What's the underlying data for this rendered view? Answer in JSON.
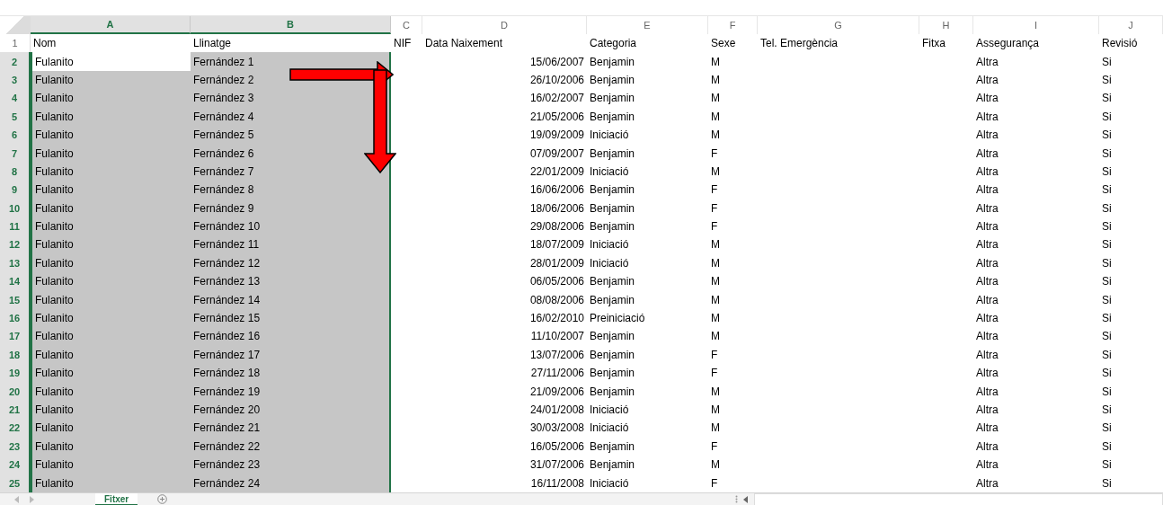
{
  "columns": [
    {
      "letter": "A",
      "selected": true
    },
    {
      "letter": "B",
      "selected": true
    },
    {
      "letter": "C",
      "selected": false
    },
    {
      "letter": "D",
      "selected": false
    },
    {
      "letter": "E",
      "selected": false
    },
    {
      "letter": "F",
      "selected": false
    },
    {
      "letter": "G",
      "selected": false
    },
    {
      "letter": "H",
      "selected": false
    },
    {
      "letter": "I",
      "selected": false
    },
    {
      "letter": "J",
      "selected": false
    }
  ],
  "header_row": {
    "number": "1",
    "cells": {
      "A": "Nom",
      "B": "Llinatge",
      "C": "NIF",
      "D": "Data Naixement",
      "E": "Categoria",
      "F": "Sexe",
      "G": "Tel. Emergència",
      "H": "Fitxa",
      "I": "Assegurança",
      "J": "Revisió"
    }
  },
  "rows": [
    {
      "number": "2",
      "selected": true,
      "active": true,
      "cells": {
        "A": "Fulanito",
        "B": "Fernández 1",
        "D": "15/06/2007",
        "E": "Benjamin",
        "F": "M",
        "I": "Altra",
        "J": "Si"
      }
    },
    {
      "number": "3",
      "selected": true,
      "active": false,
      "cells": {
        "A": "Fulanito",
        "B": "Fernández 2",
        "D": "26/10/2006",
        "E": "Benjamin",
        "F": "M",
        "I": "Altra",
        "J": "Si"
      }
    },
    {
      "number": "4",
      "selected": true,
      "active": false,
      "cells": {
        "A": "Fulanito",
        "B": "Fernández 3",
        "D": "16/02/2007",
        "E": "Benjamin",
        "F": "M",
        "I": "Altra",
        "J": "Si"
      }
    },
    {
      "number": "5",
      "selected": true,
      "active": false,
      "cells": {
        "A": "Fulanito",
        "B": "Fernández 4",
        "D": "21/05/2006",
        "E": "Benjamin",
        "F": "M",
        "I": "Altra",
        "J": "Si"
      }
    },
    {
      "number": "6",
      "selected": true,
      "active": false,
      "cells": {
        "A": "Fulanito",
        "B": "Fernández 5",
        "D": "19/09/2009",
        "E": "Iniciació",
        "F": "M",
        "I": "Altra",
        "J": "Si"
      }
    },
    {
      "number": "7",
      "selected": true,
      "active": false,
      "cells": {
        "A": "Fulanito",
        "B": "Fernández 6",
        "D": "07/09/2007",
        "E": "Benjamin",
        "F": "F",
        "I": "Altra",
        "J": "Si"
      }
    },
    {
      "number": "8",
      "selected": true,
      "active": false,
      "cells": {
        "A": "Fulanito",
        "B": "Fernández 7",
        "D": "22/01/2009",
        "E": "Iniciació",
        "F": "M",
        "I": "Altra",
        "J": "Si"
      }
    },
    {
      "number": "9",
      "selected": true,
      "active": false,
      "cells": {
        "A": "Fulanito",
        "B": "Fernández 8",
        "D": "16/06/2006",
        "E": "Benjamin",
        "F": "F",
        "I": "Altra",
        "J": "Si"
      }
    },
    {
      "number": "10",
      "selected": true,
      "active": false,
      "cells": {
        "A": "Fulanito",
        "B": "Fernández 9",
        "D": "18/06/2006",
        "E": "Benjamin",
        "F": "F",
        "I": "Altra",
        "J": "Si"
      }
    },
    {
      "number": "11",
      "selected": true,
      "active": false,
      "cells": {
        "A": "Fulanito",
        "B": "Fernández 10",
        "D": "29/08/2006",
        "E": "Benjamin",
        "F": "F",
        "I": "Altra",
        "J": "Si"
      }
    },
    {
      "number": "12",
      "selected": true,
      "active": false,
      "cells": {
        "A": "Fulanito",
        "B": "Fernández 11",
        "D": "18/07/2009",
        "E": "Iniciació",
        "F": "M",
        "I": "Altra",
        "J": "Si"
      }
    },
    {
      "number": "13",
      "selected": true,
      "active": false,
      "cells": {
        "A": "Fulanito",
        "B": "Fernández 12",
        "D": "28/01/2009",
        "E": "Iniciació",
        "F": "M",
        "I": "Altra",
        "J": "Si"
      }
    },
    {
      "number": "14",
      "selected": true,
      "active": false,
      "cells": {
        "A": "Fulanito",
        "B": "Fernández 13",
        "D": "06/05/2006",
        "E": "Benjamin",
        "F": "M",
        "I": "Altra",
        "J": "Si"
      }
    },
    {
      "number": "15",
      "selected": true,
      "active": false,
      "cells": {
        "A": "Fulanito",
        "B": "Fernández 14",
        "D": "08/08/2006",
        "E": "Benjamin",
        "F": "M",
        "I": "Altra",
        "J": "Si"
      }
    },
    {
      "number": "16",
      "selected": true,
      "active": false,
      "cells": {
        "A": "Fulanito",
        "B": "Fernández 15",
        "D": "16/02/2010",
        "E": "Preiniciació",
        "F": "M",
        "I": "Altra",
        "J": "Si"
      }
    },
    {
      "number": "17",
      "selected": true,
      "active": false,
      "cells": {
        "A": "Fulanito",
        "B": "Fernández 16",
        "D": "11/10/2007",
        "E": "Benjamin",
        "F": "M",
        "I": "Altra",
        "J": "Si"
      }
    },
    {
      "number": "18",
      "selected": true,
      "active": false,
      "cells": {
        "A": "Fulanito",
        "B": "Fernández 17",
        "D": "13/07/2006",
        "E": "Benjamin",
        "F": "F",
        "I": "Altra",
        "J": "Si"
      }
    },
    {
      "number": "19",
      "selected": true,
      "active": false,
      "cells": {
        "A": "Fulanito",
        "B": "Fernández 18",
        "D": "27/11/2006",
        "E": "Benjamin",
        "F": "F",
        "I": "Altra",
        "J": "Si"
      }
    },
    {
      "number": "20",
      "selected": true,
      "active": false,
      "cells": {
        "A": "Fulanito",
        "B": "Fernández 19",
        "D": "21/09/2006",
        "E": "Benjamin",
        "F": "M",
        "I": "Altra",
        "J": "Si"
      }
    },
    {
      "number": "21",
      "selected": true,
      "active": false,
      "cells": {
        "A": "Fulanito",
        "B": "Fernández 20",
        "D": "24/01/2008",
        "E": "Iniciació",
        "F": "M",
        "I": "Altra",
        "J": "Si"
      }
    },
    {
      "number": "22",
      "selected": true,
      "active": false,
      "cells": {
        "A": "Fulanito",
        "B": "Fernández 21",
        "D": "30/03/2008",
        "E": "Iniciació",
        "F": "M",
        "I": "Altra",
        "J": "Si"
      }
    },
    {
      "number": "23",
      "selected": true,
      "active": false,
      "cells": {
        "A": "Fulanito",
        "B": "Fernández 22",
        "D": "16/05/2006",
        "E": "Benjamin",
        "F": "F",
        "I": "Altra",
        "J": "Si"
      }
    },
    {
      "number": "24",
      "selected": true,
      "active": false,
      "cells": {
        "A": "Fulanito",
        "B": "Fernández 23",
        "D": "31/07/2006",
        "E": "Benjamin",
        "F": "M",
        "I": "Altra",
        "J": "Si"
      }
    },
    {
      "number": "25",
      "selected": true,
      "active": false,
      "cells": {
        "A": "Fulanito",
        "B": "Fernández 24",
        "D": "16/11/2008",
        "E": "Iniciació",
        "F": "F",
        "I": "Altra",
        "J": "Si"
      }
    }
  ],
  "sheet_tabs": [
    {
      "label": "Fitxer",
      "selected": true
    }
  ]
}
